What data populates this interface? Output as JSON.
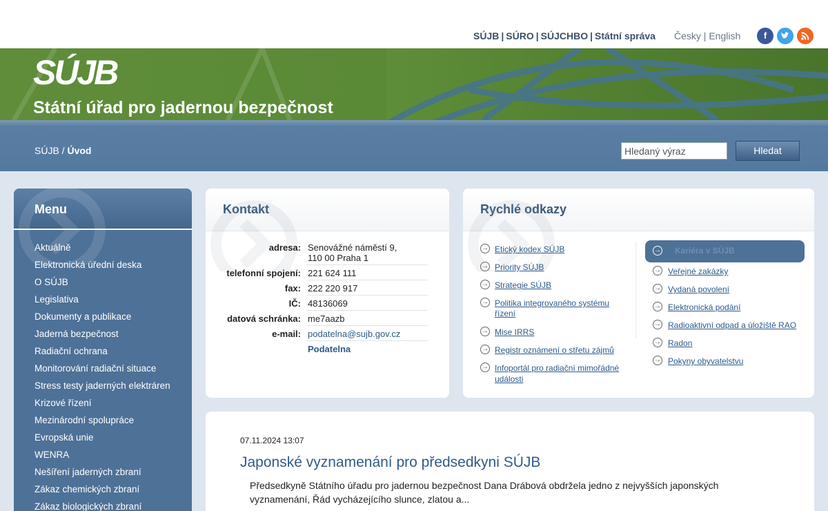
{
  "top_links": [
    "SÚJB",
    "SÚRO",
    "SÚJCHBO",
    "Státní správa"
  ],
  "languages": [
    "Česky",
    "English"
  ],
  "social": {
    "facebook": "f",
    "twitter": "t",
    "rss": "rss"
  },
  "banner": {
    "logo": "SÚJB",
    "title": "Státní úřad pro jadernou bezpečnost"
  },
  "breadcrumb": {
    "root": "SÚJB",
    "sep": " / ",
    "current": "Úvod"
  },
  "search": {
    "placeholder": "Hledaný výraz",
    "button": "Hledat"
  },
  "menu": {
    "title": "Menu",
    "items": [
      "Aktuálně",
      "Elektronická úřední deska",
      "O SÚJB",
      "Legislativa",
      "Dokumenty a publikace",
      "Jaderná bezpečnost",
      "Radiační ochrana",
      "Monitorování radiační situace",
      "Stress testy jaderných elektráren",
      "Krizové řízení",
      "Mezinárodní spolupráce",
      "Evropská unie",
      "WENRA",
      "Nešíření jaderných zbraní",
      "Zákaz chemických zbraní",
      "Zákaz biologických zbraní"
    ]
  },
  "kontakt": {
    "title": "Kontakt",
    "rows": [
      {
        "label": "adresa:",
        "value": "Senovážné náměstí 9,",
        "value2": "110 00 Praha 1"
      },
      {
        "label": "telefonní spojení:",
        "value": "221 624 111"
      },
      {
        "label": "fax:",
        "value": "222 220 917"
      },
      {
        "label": "IČ:",
        "value": "48136069"
      },
      {
        "label": "datová schránka:",
        "value": "me7aazb"
      },
      {
        "label": "e-mail:",
        "value": "podatelna@sujb.gov.cz"
      }
    ],
    "podatelna": "Podatelna"
  },
  "rychle": {
    "title": "Rychlé odkazy",
    "left": [
      "Etický kodex SÚJB",
      "Priority SÚJB",
      "Strategie SÚJB",
      "Politika integrovaného systému",
      "řízení",
      "Mise IRRS",
      "Registr oznámení o střetu zájmů",
      "Infoportál pro radiační mimořádné",
      "události"
    ],
    "right_highlight": "Kariéra v SÚJB",
    "right": [
      "Veřejné zakázky",
      "Vydaná povolení",
      "Elektronická podání",
      "Radioaktivní odpad a úložiště RAO",
      "Radon",
      "Pokyny obyvatelstvu"
    ]
  },
  "news": {
    "date": "07.11.2024 13:07",
    "title": "Japonské vyznamenání pro předsedkyni SÚJB",
    "text": "Předsedkyně Státního úřadu pro jadernou bezpečnost Dana Drábová obdržela jedno z nejvyšších japonských vyznamenání, Řád vycházejícího slunce, zlatou a..."
  },
  "colors": {
    "banner_green": "#5b8a37",
    "nav_blue": "#547aa0",
    "menu_blue": "#4e7197",
    "link": "#2b5b8a"
  }
}
